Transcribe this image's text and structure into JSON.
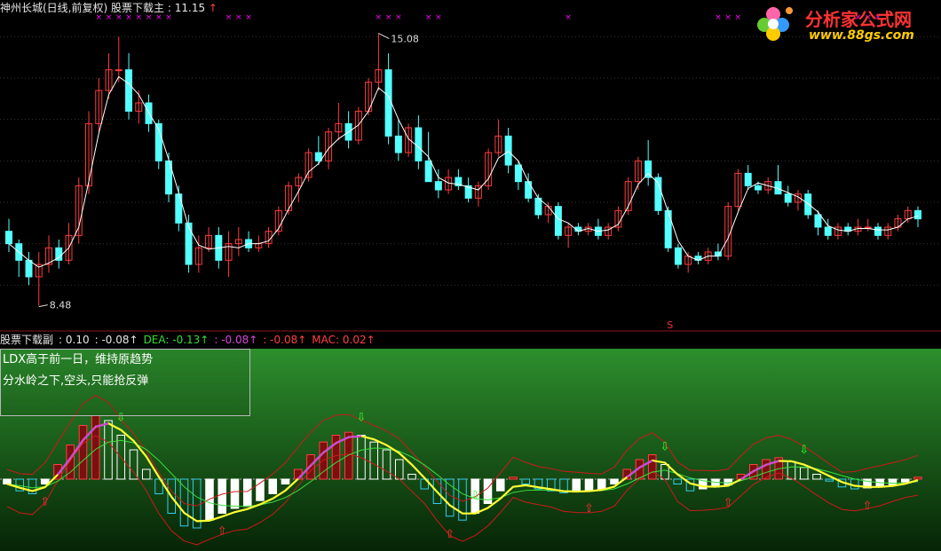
{
  "main_header": {
    "stock": "神州长城(日线,前复权)",
    "indicator": "股票下载主",
    "value": "11.15",
    "arrow": "↑"
  },
  "sub_header": [
    {
      "text": "股票下载副",
      "color": "#e6e6e6"
    },
    {
      "text": ": 0.10",
      "color": "#e6e6e6"
    },
    {
      "text": ": -0.08↑",
      "color": "#e6e6e6"
    },
    {
      "text": "DEA: -0.13↑",
      "color": "#33dd33"
    },
    {
      "text": ": -0.08↑",
      "color": "#dd44dd"
    },
    {
      "text": ": -0.08↑",
      "color": "#ff4040"
    },
    {
      "text": "MAC: 0.02↑",
      "color": "#ff4040"
    }
  ],
  "info_box": {
    "line1": "LDX高于前一日，维持原趋势",
    "line2": "分水岭之下,空头,只能抢反弹"
  },
  "logo": {
    "title": "分析家公式网",
    "url": "www.88gs.com"
  },
  "colors": {
    "up": "#ff3c3c",
    "down": "#54ffff",
    "ma": "#ffffff",
    "mark": "#ff00ff",
    "sub_bg_top": "#2d8f2d",
    "sub_bg_bottom": "#062406"
  },
  "chart_data": [
    {
      "type": "candlestick",
      "title": "神州长城(日线,前复权)",
      "ylim": [
        8.0,
        15.5
      ],
      "annotations": [
        {
          "label": "15.08",
          "value": 15.08
        },
        {
          "label": "8.48",
          "value": 8.48
        },
        {
          "label": "S"
        }
      ],
      "candles": [
        [
          10.3,
          10.6,
          9.8,
          10.0
        ],
        [
          10.0,
          10.1,
          9.2,
          9.6
        ],
        [
          9.6,
          9.8,
          9.0,
          9.2
        ],
        [
          9.2,
          9.8,
          8.5,
          9.5
        ],
        [
          9.5,
          10.2,
          9.3,
          9.9
        ],
        [
          9.9,
          10.1,
          9.4,
          9.6
        ],
        [
          9.6,
          10.5,
          9.5,
          10.2
        ],
        [
          10.2,
          11.6,
          10.0,
          11.4
        ],
        [
          11.4,
          13.2,
          11.2,
          12.9
        ],
        [
          12.9,
          14.0,
          12.7,
          13.7
        ],
        [
          13.7,
          14.6,
          13.5,
          14.2
        ],
        [
          14.2,
          15.0,
          13.9,
          14.2
        ],
        [
          14.2,
          14.6,
          13.0,
          13.2
        ],
        [
          13.2,
          13.7,
          12.9,
          13.4
        ],
        [
          13.4,
          13.6,
          12.7,
          12.9
        ],
        [
          12.9,
          13.0,
          11.8,
          12.0
        ],
        [
          12.0,
          12.2,
          11.0,
          11.2
        ],
        [
          11.2,
          11.4,
          10.3,
          10.5
        ],
        [
          10.5,
          10.7,
          9.3,
          9.5
        ],
        [
          9.5,
          10.2,
          9.3,
          9.9
        ],
        [
          9.9,
          10.4,
          9.8,
          10.2
        ],
        [
          10.2,
          10.4,
          9.4,
          9.6
        ],
        [
          9.6,
          10.3,
          9.2,
          10.0
        ],
        [
          10.0,
          10.4,
          9.7,
          10.1
        ],
        [
          10.1,
          10.3,
          9.8,
          9.9
        ],
        [
          9.9,
          10.2,
          9.8,
          10.0
        ],
        [
          10.0,
          10.4,
          9.9,
          10.3
        ],
        [
          10.3,
          10.9,
          10.2,
          10.8
        ],
        [
          10.8,
          11.5,
          10.7,
          11.4
        ],
        [
          11.4,
          11.7,
          11.0,
          11.6
        ],
        [
          11.6,
          12.3,
          11.5,
          12.2
        ],
        [
          12.2,
          12.6,
          11.9,
          12.0
        ],
        [
          12.0,
          12.8,
          11.8,
          12.7
        ],
        [
          12.7,
          13.4,
          12.5,
          12.9
        ],
        [
          12.9,
          13.2,
          12.3,
          12.5
        ],
        [
          12.5,
          13.3,
          12.4,
          13.2
        ],
        [
          13.2,
          14.0,
          13.1,
          13.9
        ],
        [
          13.9,
          15.08,
          13.7,
          14.2
        ],
        [
          14.2,
          14.6,
          12.4,
          12.6
        ],
        [
          12.6,
          13.0,
          12.0,
          12.2
        ],
        [
          12.2,
          12.9,
          12.1,
          12.8
        ],
        [
          12.8,
          13.1,
          11.8,
          12.0
        ],
        [
          12.0,
          12.7,
          11.6,
          11.5
        ],
        [
          11.5,
          11.8,
          11.1,
          11.3
        ],
        [
          11.3,
          11.8,
          11.2,
          11.6
        ],
        [
          11.6,
          11.8,
          11.3,
          11.4
        ],
        [
          11.4,
          11.6,
          11.0,
          11.1
        ],
        [
          11.1,
          11.5,
          10.9,
          11.4
        ],
        [
          11.4,
          12.3,
          11.3,
          12.2
        ],
        [
          12.2,
          13.0,
          12.1,
          12.6
        ],
        [
          12.6,
          12.8,
          11.7,
          11.9
        ],
        [
          11.9,
          12.0,
          11.3,
          11.5
        ],
        [
          11.5,
          11.7,
          11.0,
          11.1
        ],
        [
          11.1,
          11.2,
          10.6,
          10.7
        ],
        [
          10.7,
          11.0,
          10.5,
          10.9
        ],
        [
          10.9,
          11.0,
          10.1,
          10.2
        ],
        [
          10.2,
          10.5,
          9.9,
          10.4
        ],
        [
          10.4,
          10.5,
          10.2,
          10.3
        ],
        [
          10.3,
          10.5,
          10.2,
          10.4
        ],
        [
          10.4,
          10.6,
          10.1,
          10.2
        ],
        [
          10.2,
          10.5,
          10.1,
          10.4
        ],
        [
          10.4,
          10.9,
          10.3,
          10.8
        ],
        [
          10.8,
          11.6,
          10.7,
          11.5
        ],
        [
          11.5,
          12.1,
          11.3,
          12.0
        ],
        [
          12.0,
          12.5,
          11.4,
          11.6
        ],
        [
          11.6,
          11.7,
          10.7,
          10.8
        ],
        [
          10.8,
          10.9,
          9.8,
          9.9
        ],
        [
          9.9,
          10.0,
          9.4,
          9.5
        ],
        [
          9.5,
          9.8,
          9.3,
          9.7
        ],
        [
          9.7,
          9.8,
          9.5,
          9.6
        ],
        [
          9.6,
          9.9,
          9.5,
          9.8
        ],
        [
          9.8,
          10.0,
          9.6,
          9.7
        ],
        [
          9.7,
          11.0,
          9.6,
          10.9
        ],
        [
          10.9,
          11.8,
          10.8,
          11.7
        ],
        [
          11.7,
          11.9,
          11.3,
          11.4
        ],
        [
          11.4,
          11.5,
          11.2,
          11.3
        ],
        [
          11.3,
          11.6,
          11.2,
          11.5
        ],
        [
          11.5,
          11.9,
          11.4,
          11.2
        ],
        [
          11.2,
          11.4,
          10.9,
          11.0
        ],
        [
          11.0,
          11.3,
          10.8,
          11.2
        ],
        [
          11.2,
          11.3,
          10.6,
          10.7
        ],
        [
          10.7,
          10.8,
          10.2,
          10.4
        ],
        [
          10.4,
          10.6,
          10.1,
          10.2
        ],
        [
          10.2,
          10.5,
          10.1,
          10.4
        ],
        [
          10.4,
          10.5,
          10.2,
          10.3
        ],
        [
          10.3,
          10.6,
          10.2,
          10.4
        ],
        [
          10.4,
          10.6,
          10.3,
          10.4
        ],
        [
          10.4,
          10.5,
          10.1,
          10.2
        ],
        [
          10.2,
          10.5,
          10.1,
          10.4
        ],
        [
          10.4,
          10.7,
          10.3,
          10.6
        ],
        [
          10.6,
          10.9,
          10.5,
          10.8
        ],
        [
          10.8,
          10.9,
          10.4,
          10.6
        ]
      ],
      "signal_markers_count": 25
    },
    {
      "type": "macd",
      "title": "股票下载副",
      "series": [
        {
          "name": "MAC",
          "values": [
            -0.05,
            -0.12,
            -0.15,
            -0.05,
            0.15,
            0.35,
            0.55,
            0.65,
            0.6,
            0.45,
            0.3,
            0.1,
            -0.15,
            -0.35,
            -0.48,
            -0.5,
            -0.42,
            -0.35,
            -0.3,
            -0.28,
            -0.22,
            -0.15,
            -0.05,
            0.1,
            0.25,
            0.38,
            0.45,
            0.48,
            0.45,
            0.38,
            0.3,
            0.2,
            0.05,
            -0.1,
            -0.25,
            -0.38,
            -0.42,
            -0.35,
            -0.25,
            -0.12,
            0.02,
            -0.05,
            -0.1,
            -0.12,
            -0.14,
            -0.13,
            -0.12,
            -0.1,
            -0.05,
            0.1,
            0.2,
            0.25,
            0.15,
            -0.05,
            -0.12,
            -0.1,
            -0.08,
            -0.06,
            0.05,
            0.15,
            0.2,
            0.22,
            0.18,
            0.12,
            0.05,
            -0.02,
            -0.08,
            -0.1,
            -0.09,
            -0.08,
            -0.06,
            -0.03,
            0.02
          ]
        }
      ]
    }
  ]
}
